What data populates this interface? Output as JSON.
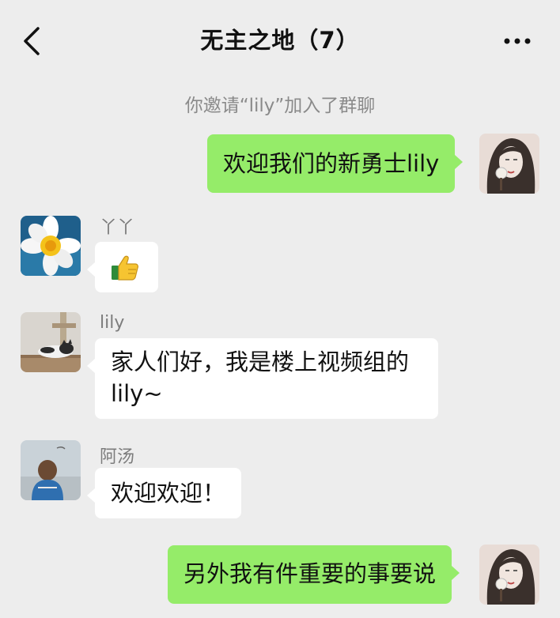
{
  "header": {
    "title": "无主之地（7）",
    "back_icon": "chevron-left-icon",
    "more_icon": "ellipsis-icon"
  },
  "system_message": "你邀请“lily”加入了群聊",
  "messages": [
    {
      "sender": "",
      "text": "欢迎我们的新勇士lily",
      "outgoing": true,
      "avatar": "woman-sketch-avatar"
    },
    {
      "sender": "丫丫",
      "text": "",
      "sticker": "thumbs-up-icon",
      "outgoing": false,
      "avatar": "daffodil-avatar"
    },
    {
      "sender": "lily",
      "text_lines": [
        "家人们好，我是楼上视频组的",
        "lily~"
      ],
      "outgoing": false,
      "avatar": "cat-avatar"
    },
    {
      "sender": "阿汤",
      "text": "欢迎欢迎！",
      "outgoing": false,
      "avatar": "child-back-avatar"
    },
    {
      "sender": "",
      "text": "另外我有件重要的事要说",
      "outgoing": true,
      "avatar": "woman-sketch-avatar"
    }
  ],
  "colors": {
    "background": "#ededed",
    "outgoing_bubble": "#95ec69",
    "incoming_bubble": "#ffffff",
    "system_text": "#8a8a8a"
  }
}
